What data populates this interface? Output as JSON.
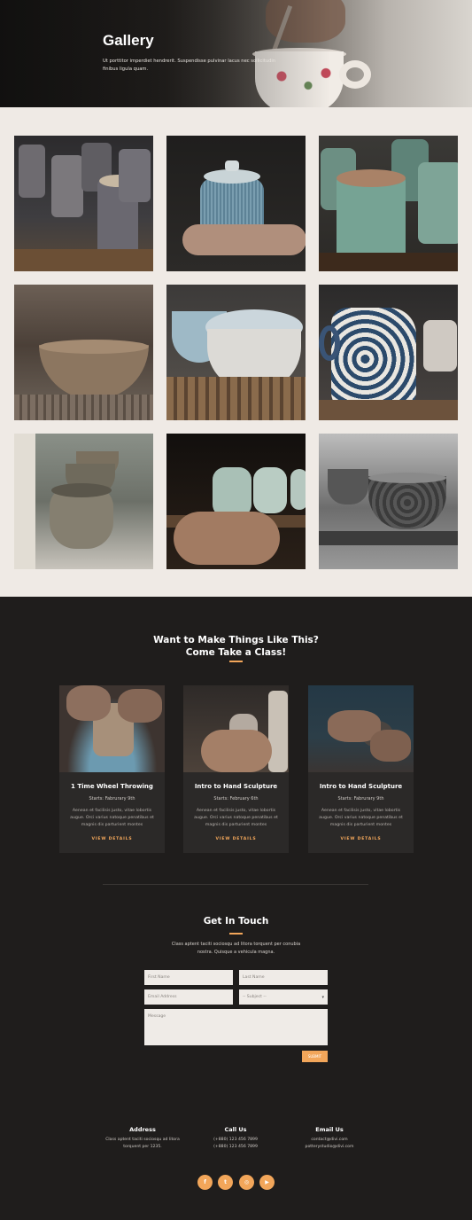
{
  "hero": {
    "title": "Gallery",
    "description": "Ut porttitor imperdiet hendrerit. Suspendisse pulvinar lacus nec sollicitudin finibus ligula quam."
  },
  "gallery": {
    "images": [
      {
        "name": "stacked-cups"
      },
      {
        "name": "lidded-jar-in-hands"
      },
      {
        "name": "green-cylinder-pots"
      },
      {
        "name": "clay-bowl-on-rack"
      },
      {
        "name": "stacked-white-bowls"
      },
      {
        "name": "blue-floral-pitcher"
      },
      {
        "name": "small-clay-pots-row"
      },
      {
        "name": "pale-green-cups-in-hands"
      },
      {
        "name": "monochrome-mugs"
      }
    ]
  },
  "classes": {
    "heading_line1": "Want to Make Things Like This?",
    "heading_line2": "Come Take a Class!",
    "cards": [
      {
        "title": "1 Time Wheel Throwing",
        "starts": "Starts: Fabrurary 9th",
        "desc": "Aenean et facilisis justo, vitae lobortis augue. Orci varius natoque penatibus et magnis dis parturient montes",
        "link": "VIEW DETAILS"
      },
      {
        "title": "Intro to Hand Sculpture",
        "starts": "Starts: February 6th",
        "desc": "Aenean et facilisis justo, vitae lobortis augue. Orci varius natoque penatibus et magnis dis parturient montes",
        "link": "VIEW DETAILS"
      },
      {
        "title": "Intro to Hand Sculpture",
        "starts": "Starts: Fabrurary 9th",
        "desc": "Aenean et facilisis justo, vitae lobortis augue. Orci varius natoque penatibus et magnis dis parturient montes",
        "link": "VIEW DETAILS"
      }
    ]
  },
  "contact": {
    "heading": "Get In Touch",
    "subtext": "Class aptent taciti sociosqu ad litora torquent per conubia nostra. Quisque a vehicula magna.",
    "first_name_placeholder": "First Name",
    "last_name_placeholder": "Last Name",
    "email_placeholder": "Email Address",
    "subject_placeholder": "-- Subject --",
    "message_placeholder": "Message",
    "submit_label": "SUBMIT"
  },
  "info": {
    "address": {
      "heading": "Address",
      "lines": [
        "Class aptent taciti sociosqu ad litora",
        "torquent per 1235."
      ]
    },
    "call": {
      "heading": "Call Us",
      "lines": [
        "(+880) 123 456 7899",
        "(+880) 123 456 7899"
      ]
    },
    "email": {
      "heading": "Email Us",
      "lines": [
        "contact@divi.com",
        "potterystudio@divi.com"
      ]
    }
  },
  "social": {
    "items": [
      {
        "name": "facebook-icon",
        "glyph": "f"
      },
      {
        "name": "twitter-icon",
        "glyph": "t"
      },
      {
        "name": "instagram-icon",
        "glyph": "◎"
      },
      {
        "name": "youtube-icon",
        "glyph": "▶"
      }
    ]
  },
  "colors": {
    "accent": "#f2a65a",
    "dark_bg": "#1f1d1c",
    "card_bg": "#2b2928",
    "gallery_bg": "#efeae5"
  }
}
